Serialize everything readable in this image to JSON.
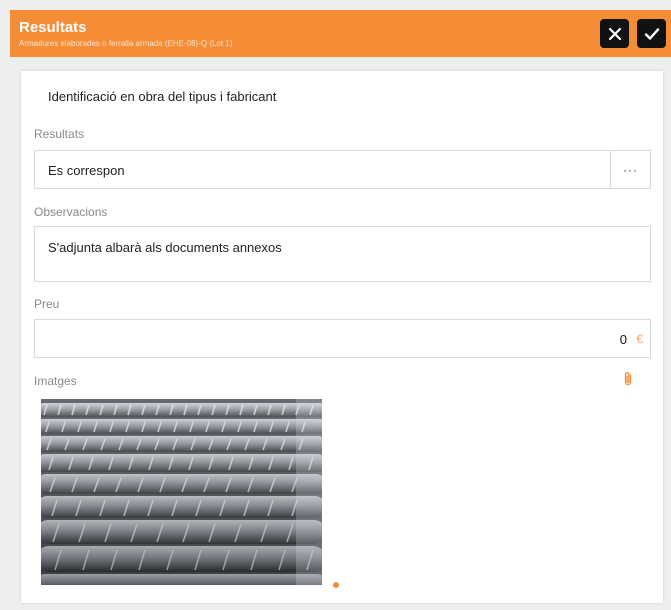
{
  "header": {
    "title": "Resultats",
    "subtitle": "Armadures elaborades o ferralla armada (EHE-08)-Q (Lot 1)",
    "close_icon": "close-icon",
    "confirm_icon": "check-icon"
  },
  "form": {
    "item_title": "Identificació en obra del tipus i fabricant",
    "results": {
      "label": "Resultats",
      "value": "Es correspon",
      "more_label": "···"
    },
    "observations": {
      "label": "Observacions",
      "value": "S'adjunta albarà als documents annexos"
    },
    "price": {
      "label": "Preu",
      "value": "0",
      "currency": "€"
    },
    "images": {
      "label": "Imatges",
      "attach_icon": "paperclip-icon",
      "photo": "rebar-photo",
      "pager_count": 1
    }
  },
  "colors": {
    "accent": "#f58c36",
    "header_buttons": "#111111"
  }
}
